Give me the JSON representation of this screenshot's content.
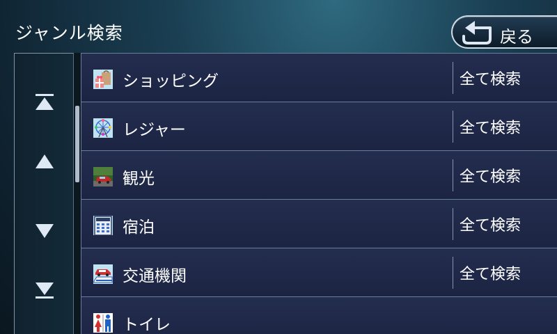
{
  "header": {
    "title": "ジャンル検索",
    "back_label": "戻る"
  },
  "nav": {
    "top_icon": "skip-to-top-icon",
    "up_icon": "page-up-icon",
    "down_icon": "page-down-icon",
    "bottom_icon": "skip-to-bottom-icon"
  },
  "scroll": {
    "position_fraction": 0.1,
    "visible_fraction": 0.28
  },
  "list": {
    "items": [
      {
        "label": "ショッピング",
        "icon": "shopping-icon",
        "search_label": "全て検索"
      },
      {
        "label": "レジャー",
        "icon": "leisure-ferris-wheel-icon",
        "search_label": "全て検索"
      },
      {
        "label": "観光",
        "icon": "sightseeing-car-icon",
        "search_label": "全て検索"
      },
      {
        "label": "宿泊",
        "icon": "hotel-icon",
        "search_label": "全て検索"
      },
      {
        "label": "交通機関",
        "icon": "transportation-icon",
        "search_label": "全て検索"
      },
      {
        "label": "トイレ",
        "icon": "restroom-icon",
        "search_label": ""
      }
    ]
  },
  "colors": {
    "row_background": "#232d4e",
    "row_border": "#6b7d9c",
    "nav_arrow": "#dfe9f5"
  }
}
